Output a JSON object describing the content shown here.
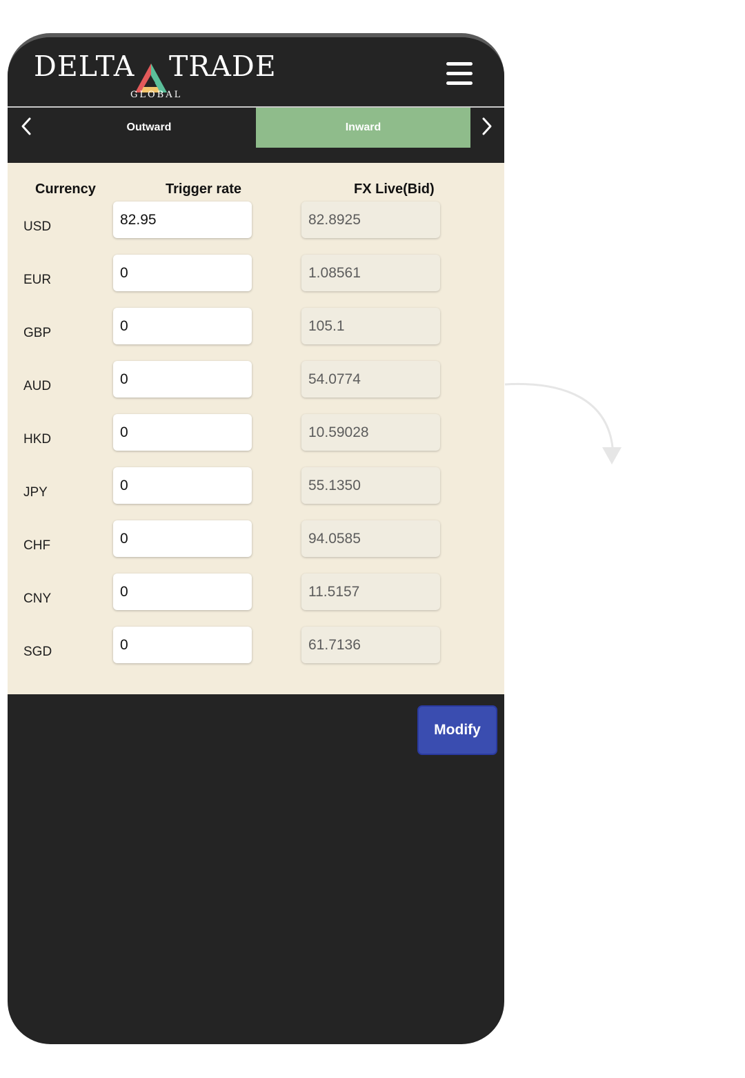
{
  "brand": {
    "name_left": "DELTA",
    "name_right": "TRADE",
    "subtitle": "GLOBAL",
    "logo_colors": [
      "#e35a5a",
      "#f2c46b",
      "#5bbf9a"
    ]
  },
  "header": {
    "menu_icon": "hamburger-menu-icon"
  },
  "tabs": {
    "items": [
      {
        "label": "Outward",
        "active": false
      },
      {
        "label": "Inward",
        "active": true
      }
    ],
    "active_color": "#8fbc8b"
  },
  "table": {
    "headers": {
      "currency": "Currency",
      "trigger": "Trigger rate",
      "live": "FX Live(Bid)"
    },
    "rows": [
      {
        "currency": "USD",
        "trigger": "82.95",
        "live": "82.8925"
      },
      {
        "currency": "EUR",
        "trigger": "0",
        "live": "1.08561"
      },
      {
        "currency": "GBP",
        "trigger": "0",
        "live": "105.1"
      },
      {
        "currency": "AUD",
        "trigger": "0",
        "live": "54.0774"
      },
      {
        "currency": "HKD",
        "trigger": "0",
        "live": "10.59028"
      },
      {
        "currency": "JPY",
        "trigger": "0",
        "live": "55.1350"
      },
      {
        "currency": "CHF",
        "trigger": "0",
        "live": "94.0585"
      },
      {
        "currency": "CNY",
        "trigger": "0",
        "live": "11.5157"
      },
      {
        "currency": "SGD",
        "trigger": "0",
        "live": "61.7136"
      }
    ]
  },
  "actions": {
    "modify_label": "Modify",
    "modify_color": "#3a4db0"
  }
}
